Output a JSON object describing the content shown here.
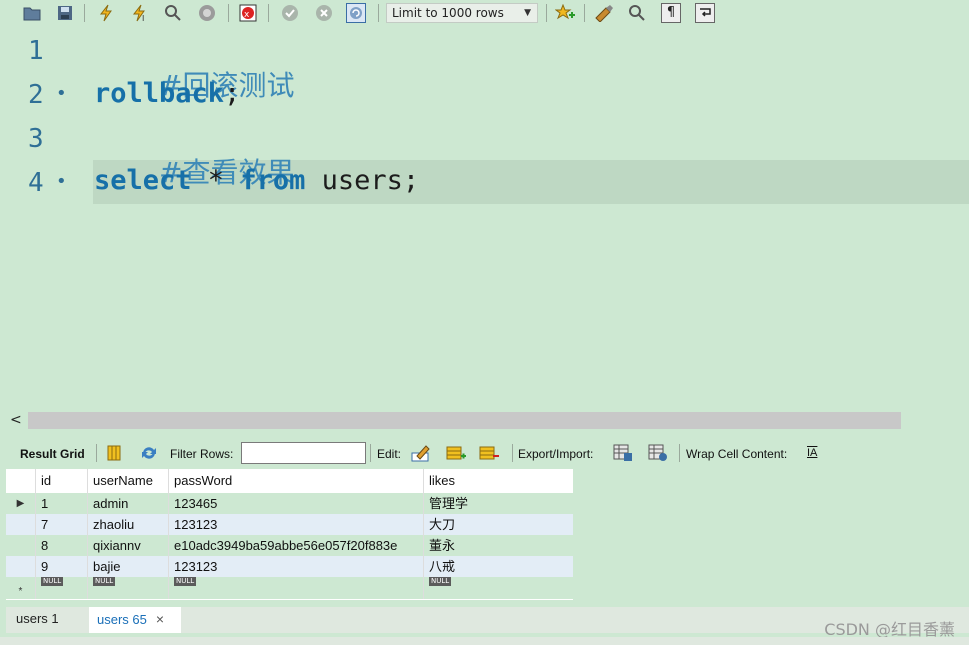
{
  "toolbar": {
    "icons": [
      "open-folder-icon",
      "save-icon",
      "execute-icon",
      "execute-current-icon",
      "explain-icon",
      "stop-icon",
      "toggle-error-icon",
      "commit-icon",
      "rollback-icon",
      "autocommit-icon",
      "bookmark-icon",
      "beautify-icon",
      "find-icon",
      "invisible-chars-icon",
      "wrap-icon"
    ],
    "limit_label": "Limit to 1000 rows"
  },
  "editor": {
    "lines": [
      {
        "number": "1",
        "marker": "",
        "text": "#回滚测试"
      },
      {
        "number": "2",
        "marker": "•",
        "kw": "rollback",
        "rest": ";"
      },
      {
        "number": "3",
        "marker": "",
        "text": "#查看效果"
      },
      {
        "number": "4",
        "marker": "•",
        "kw1": "select",
        "mid": " * ",
        "kw2": "from",
        "rest": " users;"
      }
    ]
  },
  "scrollbar": {
    "left_arrow": "<"
  },
  "result_toolbar": {
    "result_grid_label": "Result Grid",
    "filter_label": "Filter Rows:",
    "filter_value": "",
    "edit_label": "Edit:",
    "export_label": "Export/Import:",
    "wrap_label": "Wrap Cell Content:",
    "wrap_icon": "IA"
  },
  "grid": {
    "columns": [
      "id",
      "userName",
      "passWord",
      "likes"
    ],
    "rows": [
      {
        "marker": "▶",
        "id": "1",
        "userName": "admin",
        "passWord": "123465",
        "likes": "管理学"
      },
      {
        "marker": "",
        "id": "7",
        "userName": "zhaoliu",
        "passWord": "123123",
        "likes": "大刀"
      },
      {
        "marker": "",
        "id": "8",
        "userName": "qixiannv",
        "passWord": "e10adc3949ba59abbe56e057f20f883e",
        "likes": "董永"
      },
      {
        "marker": "",
        "id": "9",
        "userName": "bajie",
        "passWord": "123123",
        "likes": "八戒"
      }
    ],
    "new_row_marker": "*",
    "null_label": "NULL"
  },
  "tabs": {
    "tab1": "users 1",
    "tab2": "users 65",
    "close": "×"
  },
  "watermark": "CSDN @红目香薰"
}
